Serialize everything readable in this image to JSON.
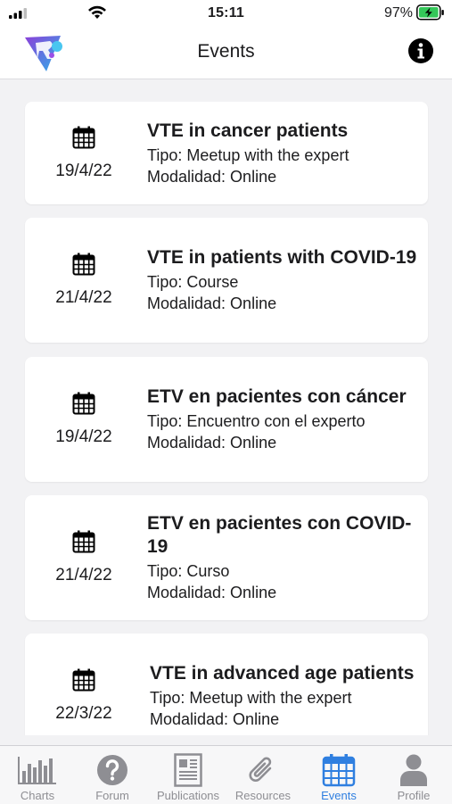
{
  "status_bar": {
    "time": "15:11",
    "battery": "97%"
  },
  "header": {
    "title": "Events",
    "logo_icon": "app-logo",
    "info_icon": "info-icon"
  },
  "events": [
    {
      "date": "19/4/22",
      "title": "VTE in cancer patients",
      "type": "Tipo: Meetup with the expert",
      "mode": "Modalidad: Online"
    },
    {
      "date": "21/4/22",
      "title": "VTE in patients with COVID-19",
      "type": "Tipo: Course",
      "mode": "Modalidad: Online"
    },
    {
      "date": "19/4/22",
      "title": "ETV en pacientes con cáncer",
      "type": "Tipo: Encuentro con el experto",
      "mode": "Modalidad: Online"
    },
    {
      "date": "21/4/22",
      "title": "ETV en pacientes con COVID-19",
      "type": "Tipo: Curso",
      "mode": "Modalidad: Online"
    },
    {
      "date": "22/3/22",
      "title": "VTE in advanced age patients",
      "type": "Tipo: Meetup with the expert",
      "mode": "Modalidad: Online"
    }
  ],
  "tabs": [
    {
      "label": "Charts",
      "icon": "bar-chart-icon"
    },
    {
      "label": "Forum",
      "icon": "question-icon"
    },
    {
      "label": "Publications",
      "icon": "document-icon"
    },
    {
      "label": "Resources",
      "icon": "paperclip-icon"
    },
    {
      "label": "Events",
      "icon": "calendar-icon"
    },
    {
      "label": "Profile",
      "icon": "person-icon"
    }
  ],
  "colors": {
    "active_tab": "#2f7fe0",
    "inactive_tab": "#8e8e93",
    "background": "#f2f2f4",
    "battery": "#34c759"
  }
}
